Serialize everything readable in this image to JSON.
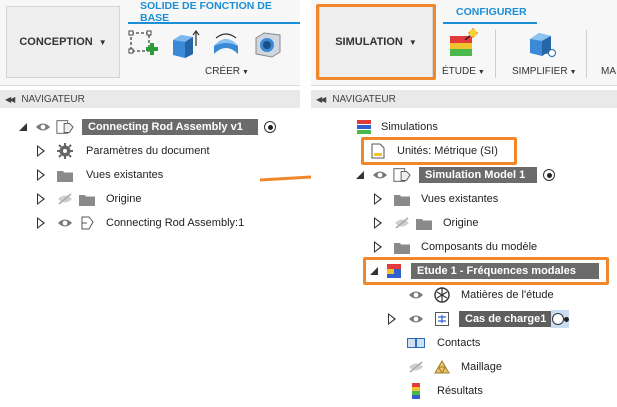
{
  "left": {
    "workspace_button": "CONCEPTION",
    "tab": "SOLIDE DE FONCTION DE BASE",
    "group": "CRÉER",
    "navigator": "NAVIGATEUR",
    "tree": {
      "root": "Connecting Rod Assembly v1",
      "items": [
        "Paramètres du document",
        "Vues existantes",
        "Origine",
        "Connecting Rod Assembly:1"
      ]
    }
  },
  "right": {
    "workspace_button": "SIMULATION",
    "tab": "CONFIGURER",
    "group_etude": "ÉTUDE",
    "group_simplifier": "SIMPLIFIER",
    "group_cut": "MA",
    "navigator": "NAVIGATEUR",
    "tree": {
      "simulations": "Simulations",
      "units": "Unités: Métrique (SI)",
      "model": "Simulation Model 1",
      "model_items": [
        "Vues existantes",
        "Origine",
        "Composants du modèle"
      ],
      "study": "Etude 1 - Fréquences modales",
      "study_items": {
        "materials": "Matières de l'étude",
        "load_case": "Cas de charge1",
        "contacts": "Contacts",
        "mesh": "Maillage",
        "results": "Résultats"
      }
    }
  },
  "colors": {
    "accent_blue": "#1a8fd6",
    "highlight_orange": "#f0882b",
    "selected_gray": "#6b6b6b"
  }
}
